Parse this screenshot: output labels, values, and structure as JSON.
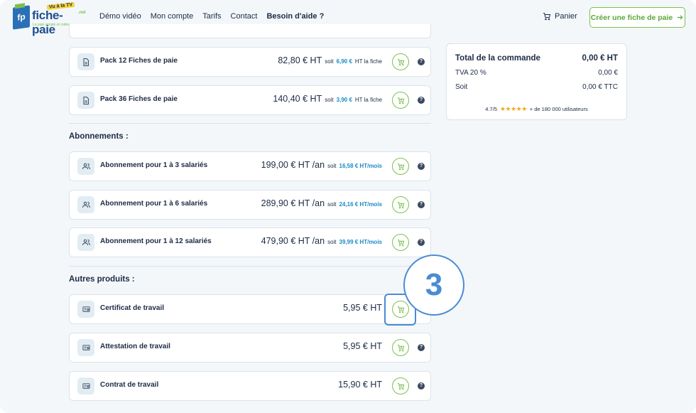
{
  "header": {
    "logo": {
      "word": "fiche-paie",
      "badge": "Vu à la TV",
      "suffix": ".net",
      "tagline": "La paie simple et rodée"
    },
    "nav": [
      {
        "label": "Démo vidéo",
        "bold": false
      },
      {
        "label": "Mon compte",
        "bold": false
      },
      {
        "label": "Tarifs",
        "bold": false
      },
      {
        "label": "Contact",
        "bold": false
      },
      {
        "label": "Besoin d'aide ?",
        "bold": true
      }
    ],
    "cart_label": "Panier",
    "cta_label": "Créer une fiche de paie"
  },
  "packs": [
    {
      "name": "Pack 12 Fiches de paie",
      "price": "82,80 € HT",
      "soit": "soit",
      "unit_price": "6,90 €",
      "unit_suffix": "HT la fiche"
    },
    {
      "name": "Pack 36 Fiches de paie",
      "price": "140,40 € HT",
      "soit": "soit",
      "unit_price": "3,90 €",
      "unit_suffix": "HT la fiche"
    }
  ],
  "sections": {
    "abonnements": "Abonnements :",
    "autres": "Autres produits :"
  },
  "subscriptions": [
    {
      "name": "Abonnement pour 1 à 3 salariés",
      "price": "199,00 € HT /an",
      "soit": "soit",
      "monthly": "16,58 € HT/mois"
    },
    {
      "name": "Abonnement pour 1 à 6 salariés",
      "price": "289,90 € HT /an",
      "soit": "soit",
      "monthly": "24,16 € HT/mois"
    },
    {
      "name": "Abonnement pour 1 à 12 salariés",
      "price": "479,90 € HT /an",
      "soit": "soit",
      "monthly": "39,99 € HT/mois"
    }
  ],
  "others": [
    {
      "name": "Certificat de travail",
      "price": "5,95 € HT"
    },
    {
      "name": "Attestation de travail",
      "price": "5,95 € HT"
    },
    {
      "name": "Contrat de travail",
      "price": "15,90 € HT"
    }
  ],
  "summary": {
    "total_label": "Total de la commande",
    "total_value": "0,00 € HT",
    "tva_label": "TVA 20 %",
    "tva_value": "0,00 €",
    "soit_label": "Soit",
    "soit_value": "0,00 € TTC",
    "rating": "4.7/5",
    "stars": "★★★★★",
    "users": "+ de 180 000 utilisateurs"
  },
  "help_glyph": "?",
  "step_number": "3",
  "colors": {
    "accent_green": "#7cc04b",
    "brand_blue": "#1f4f8f",
    "price_blue": "#1a8ac7",
    "annotation_blue": "#4a8bd4"
  }
}
